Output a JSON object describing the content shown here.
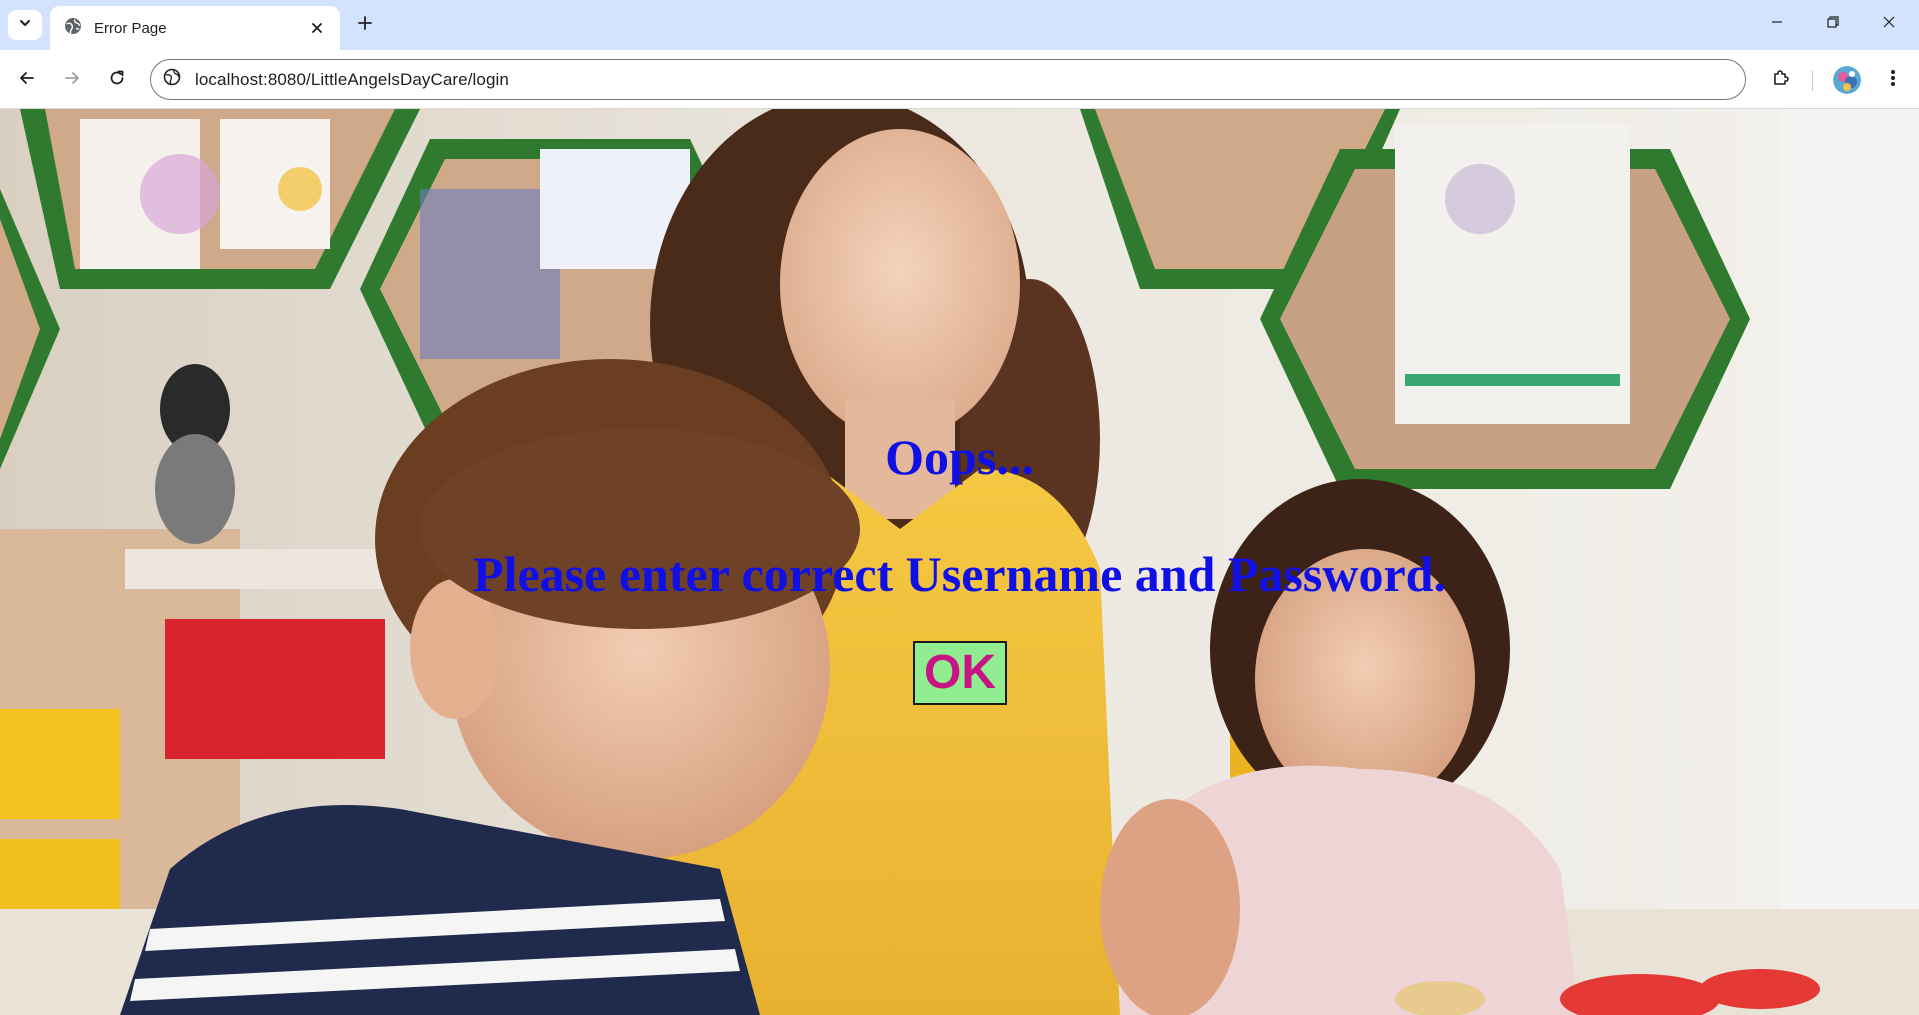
{
  "browser": {
    "tab": {
      "title": "Error Page",
      "icon": "globe-icon"
    },
    "address_bar": {
      "url": "localhost:8080/LittleAngelsDayCare/login",
      "site_icon": "site-info-icon"
    },
    "icons": {
      "tab_search": "chevron-down-icon",
      "close_tab": "close-icon",
      "new_tab": "plus-icon",
      "minimize": "minimize-icon",
      "restore": "restore-icon",
      "close_window": "close-window-icon",
      "back": "arrow-left-icon",
      "forward": "arrow-right-icon",
      "reload": "reload-icon",
      "extensions": "puzzle-icon",
      "profile": "avatar",
      "menu": "kebab-menu-icon"
    }
  },
  "page": {
    "heading": "Oops...",
    "message": "Please enter correct Username and Password.",
    "ok_label": "OK"
  },
  "colors": {
    "text_blue": "#1010e6",
    "button_bg": "#90ee90",
    "button_text": "#c71585",
    "tabstrip_bg": "#d3e3fd"
  }
}
